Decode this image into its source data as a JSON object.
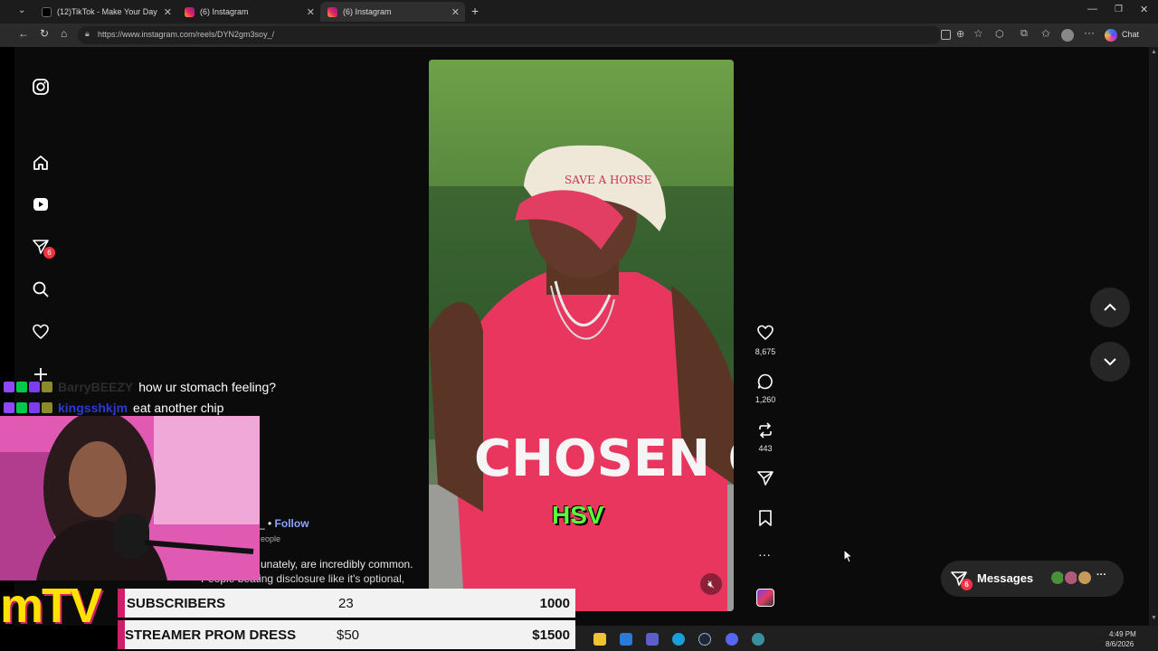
{
  "browser": {
    "tabs": [
      {
        "title": "(12)TikTok - Make Your Day"
      },
      {
        "title": "(6) Instagram"
      },
      {
        "title": "(6) Instagram"
      }
    ],
    "url": "https://www.instagram.com/reels/DYN2gm3soy_/",
    "chat_label": "Chat"
  },
  "sidebar": {
    "notifications_badge": "6"
  },
  "reel": {
    "caption_overlay": "HSV",
    "likes": "8,675",
    "comments": "1,260",
    "reposts": "443",
    "follow_label": "Follow",
    "people_text": "eople",
    "description_line1": "unately, are incredibly common.",
    "description_line2": "People beating disclosure like it's optional,",
    "cap_text_1": "SAVE A HORSE",
    "shirt_text": "CHOSEN ONE"
  },
  "messages": {
    "label": "Messages",
    "badge": "6"
  },
  "stream_chat": [
    {
      "user": "BarryBEEZY",
      "message": "how ur stomach feeling?",
      "user_color": "#2d2d2d"
    },
    {
      "user": "kingsshkjm",
      "message": "eat another chip",
      "user_color": "#2a39d8"
    }
  ],
  "overlay": {
    "logo": "mTV",
    "rows": [
      {
        "label": "SUBSCRIBERS",
        "current": "23",
        "goal": "1000"
      },
      {
        "label": "STREAMER PROM DRESS",
        "current": "$50",
        "goal": "$1500"
      }
    ]
  },
  "taskbar": {
    "time": "4:49 PM",
    "date": "8/6/2026"
  }
}
